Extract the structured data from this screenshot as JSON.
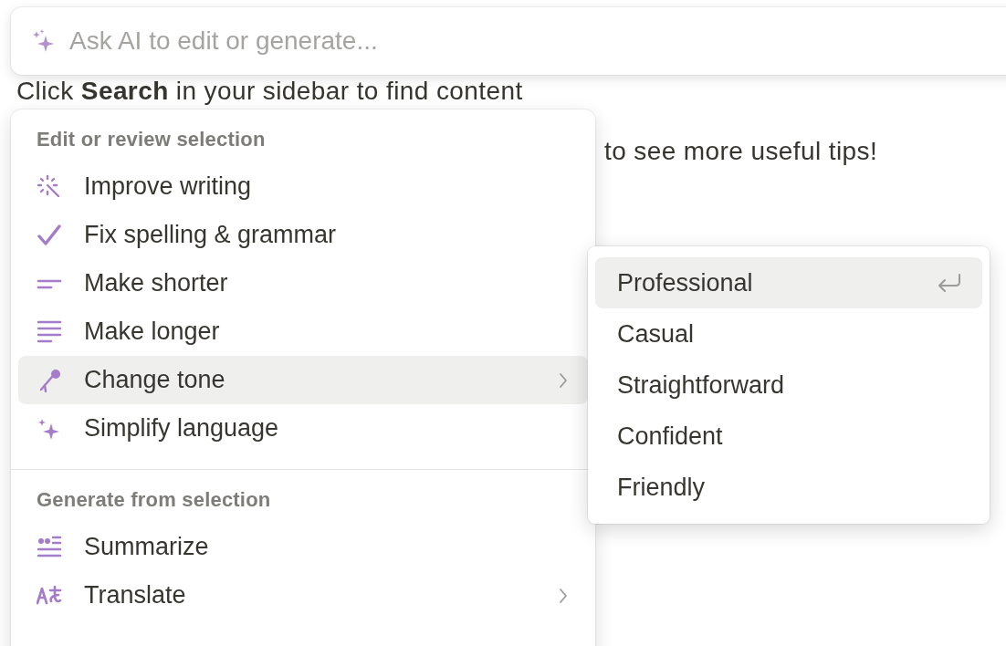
{
  "document": {
    "line_1": "Click **Search** in your sidebar to find content",
    "line_2": "to see more useful tips!"
  },
  "ai_prompt": {
    "placeholder": "Ask AI to edit or generate..."
  },
  "menu": {
    "sections": [
      {
        "heading": "Edit or review selection",
        "items": [
          {
            "label": "Improve writing",
            "selected": false,
            "submenu": false
          },
          {
            "label": "Fix spelling & grammar",
            "selected": false,
            "submenu": false
          },
          {
            "label": "Make shorter",
            "selected": false,
            "submenu": false
          },
          {
            "label": "Make longer",
            "selected": false,
            "submenu": false
          },
          {
            "label": "Change tone",
            "selected": true,
            "submenu": true
          },
          {
            "label": "Simplify language",
            "selected": false,
            "submenu": false
          }
        ]
      },
      {
        "heading": "Generate from selection",
        "items": [
          {
            "label": "Summarize",
            "selected": false,
            "submenu": false
          },
          {
            "label": "Translate",
            "selected": false,
            "submenu": true
          }
        ]
      }
    ]
  },
  "submenu": {
    "options": [
      {
        "label": "Professional",
        "selected": true
      },
      {
        "label": "Casual",
        "selected": false
      },
      {
        "label": "Straightforward",
        "selected": false
      },
      {
        "label": "Confident",
        "selected": false
      },
      {
        "label": "Friendly",
        "selected": false
      }
    ]
  }
}
